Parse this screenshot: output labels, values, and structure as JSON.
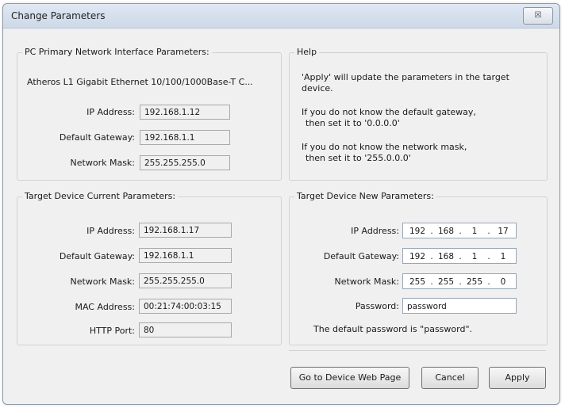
{
  "window": {
    "title": "Change Parameters",
    "close_label": "☒"
  },
  "pc_group": {
    "legend": "PC Primary Network Interface Parameters:",
    "adapter": "Atheros L1 Gigabit Ethernet 10/100/1000Base-T C...",
    "ip_label": "IP Address:",
    "ip_value": "192.168.1.12",
    "gw_label": "Default Gateway:",
    "gw_value": "192.168.1.1",
    "mask_label": "Network Mask:",
    "mask_value": "255.255.255.0"
  },
  "help_group": {
    "legend": "Help",
    "line1": "'Apply' will update the parameters in the target",
    "line2": "device.",
    "line3": "If you do not know the default gateway,",
    "line4": "then set it to '0.0.0.0'",
    "line5": "If you do not know the network mask,",
    "line6": "then set it to '255.0.0.0'"
  },
  "current_group": {
    "legend": "Target Device Current Parameters:",
    "ip_label": "IP Address:",
    "ip_value": "192.168.1.17",
    "gw_label": "Default Gateway:",
    "gw_value": "192.168.1.1",
    "mask_label": "Network Mask:",
    "mask_value": "255.255.255.0",
    "mac_label": "MAC Address:",
    "mac_value": "00:21:74:00:03:15",
    "port_label": "HTTP Port:",
    "port_value": "80"
  },
  "new_group": {
    "legend": "Target Device New Parameters:",
    "ip_label": "IP Address:",
    "ip": [
      "192",
      "168",
      "1",
      "17"
    ],
    "gw_label": "Default Gateway:",
    "gw": [
      "192",
      "168",
      "1",
      "1"
    ],
    "mask_label": "Network Mask:",
    "mask": [
      "255",
      "255",
      "255",
      "0"
    ],
    "pw_label": "Password:",
    "pw_value": "password",
    "pw_hint": "The default password is \"password\"."
  },
  "buttons": {
    "web_page": "Go to Device Web Page",
    "cancel": "Cancel",
    "apply": "Apply"
  },
  "ip_dot": "."
}
